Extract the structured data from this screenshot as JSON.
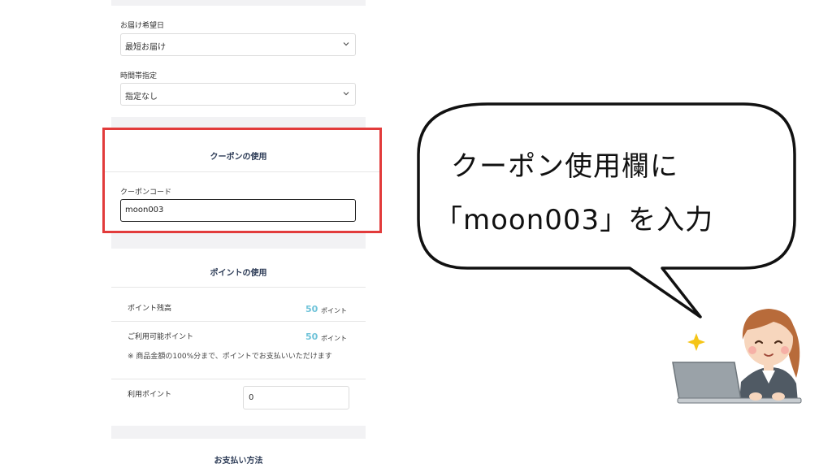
{
  "delivery": {
    "date_label": "お届け希望日",
    "date_value": "最短お届け",
    "time_label": "時間帯指定",
    "time_value": "指定なし"
  },
  "coupon": {
    "title": "クーポンの使用",
    "code_label": "クーポンコード",
    "code_value": "moon003"
  },
  "points": {
    "title": "ポイントの使用",
    "balance_label": "ポイント残高",
    "balance_value": "50",
    "balance_unit": "ポイント",
    "available_label": "ご利用可能ポイント",
    "available_value": "50",
    "available_unit": "ポイント",
    "note": "※ 商品金額の100%分まで、ポイントでお支払いいただけます",
    "use_label": "利用ポイント",
    "use_value": "0"
  },
  "payment": {
    "title": "お支払い方法"
  },
  "bubble": {
    "line1": "クーポン使用欄に",
    "line2": "「moon003」を入力"
  },
  "icons": [
    "chevron-down-icon",
    "sparkle-icon",
    "woman-laptop-illustration"
  ],
  "colors": {
    "highlight": "#e23b3b",
    "points_accent": "#6fc3d9",
    "title_text": "#2b3a55"
  }
}
